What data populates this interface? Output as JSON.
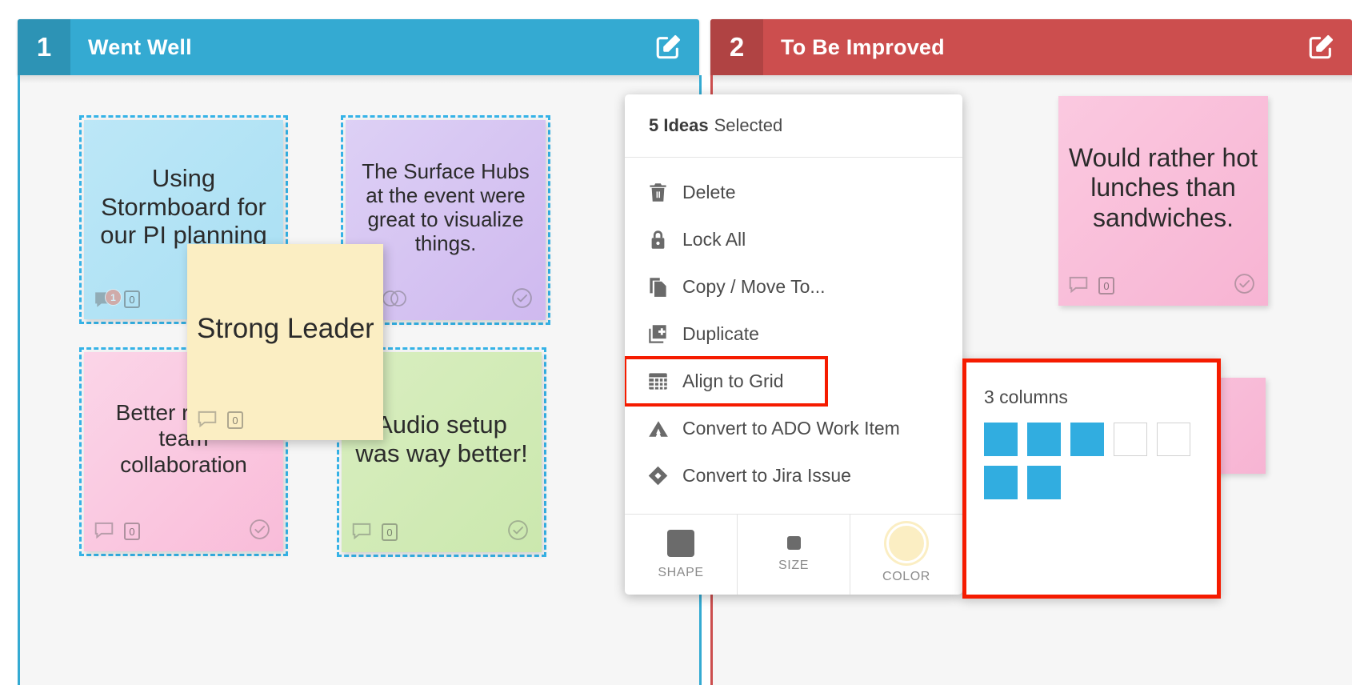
{
  "columns": [
    {
      "number": "1",
      "title": "Went Well",
      "accent": "#34aad2",
      "accent_dark": "#2d93b5",
      "edit_icon": "edit-square-icon"
    },
    {
      "number": "2",
      "title": "To Be Improved",
      "accent": "#cc4e4e",
      "accent_dark": "#b04343",
      "edit_icon": "edit-square-icon"
    }
  ],
  "notes": [
    {
      "id": "note-using-stormboard",
      "text": "Using Stormboard for our PI planning",
      "color": "blue",
      "selected": true,
      "comment_badge": "1",
      "vote_count": "0",
      "has_check": false
    },
    {
      "id": "note-surface-hubs",
      "text": "The Surface Hubs at the event were great to visualize things.",
      "color": "purple",
      "selected": true,
      "comment_badge": "",
      "vote_count": "2",
      "has_check": true
    },
    {
      "id": "note-remote-collaboration",
      "text": "Better remote team collaboration",
      "color": "pink",
      "selected": true,
      "comment_badge": "",
      "vote_count": "0",
      "has_check": true
    },
    {
      "id": "note-audio-setup",
      "text": "Audio setup was way better!",
      "color": "green",
      "selected": true,
      "comment_badge": "",
      "vote_count": "0",
      "has_check": true
    },
    {
      "id": "note-strong-leadership",
      "text": "Strong Leadership",
      "color": "yellow",
      "selected": false,
      "comment_badge": "",
      "vote_count": "0",
      "has_check": false
    },
    {
      "id": "note-hot-lunches",
      "text": "Would rather hot lunches than sandwiches.",
      "color": "pink2",
      "selected": false,
      "comment_badge": "",
      "vote_count": "0",
      "has_check": true
    }
  ],
  "context_menu": {
    "header_count": "5 Ideas",
    "header_suffix": "Selected",
    "items": [
      {
        "label": "Delete",
        "icon": "trash-icon",
        "has_submenu": false,
        "highlighted": false
      },
      {
        "label": "Lock All",
        "icon": "lock-icon",
        "has_submenu": false,
        "highlighted": false
      },
      {
        "label": "Copy / Move To...",
        "icon": "copy-icon",
        "has_submenu": false,
        "highlighted": false
      },
      {
        "label": "Duplicate",
        "icon": "duplicate-icon",
        "has_submenu": false,
        "highlighted": false
      },
      {
        "label": "Align to Grid",
        "icon": "grid-icon",
        "has_submenu": true,
        "highlighted": true
      },
      {
        "label": "Convert to ADO Work Item",
        "icon": "azure-devops-icon",
        "has_submenu": false,
        "highlighted": false
      },
      {
        "label": "Convert to Jira Issue",
        "icon": "jira-icon",
        "has_submenu": false,
        "highlighted": false
      }
    ],
    "footer": [
      {
        "label": "SHAPE",
        "icon": "shape-square-icon"
      },
      {
        "label": "SIZE",
        "icon": "size-square-icon"
      },
      {
        "label": "COLOR",
        "icon": "color-circle-icon"
      }
    ]
  },
  "submenu": {
    "title": "3 columns",
    "grid_cells": [
      true,
      true,
      true,
      false,
      false,
      true,
      true,
      false,
      false,
      false
    ],
    "filled_color": "#31ade0",
    "highlight_color": "#f51b00"
  }
}
